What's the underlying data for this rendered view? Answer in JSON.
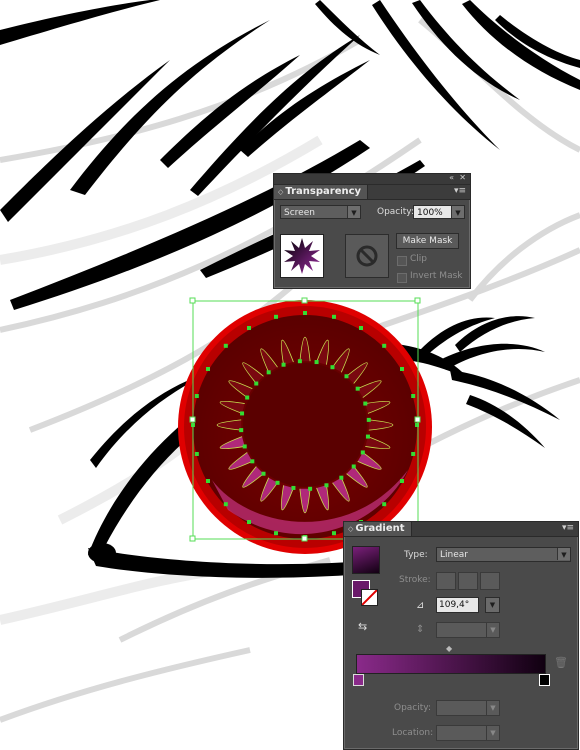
{
  "transparency": {
    "title": "Transparency",
    "blend_mode": "Screen",
    "opacity_label": "Opacity:",
    "opacity_value": "100%",
    "make_mask_label": "Make Mask",
    "clip_label": "Clip",
    "invert_mask_label": "Invert Mask"
  },
  "gradient": {
    "title": "Gradient",
    "type_label": "Type:",
    "type_value": "Linear",
    "stroke_label": "Stroke:",
    "angle_value": "109,4°",
    "opacity_label": "Opacity:",
    "location_label": "Location:",
    "stops": [
      {
        "color": "#8a2a8a",
        "location": 0
      },
      {
        "color": "#000000",
        "location": 100
      }
    ]
  },
  "colors": {
    "iris_outer": "#d40000",
    "iris_inner": "#6a0000",
    "path_anchor": "#33dd33",
    "gradient_start": "#8a2a8a",
    "gradient_end": "#120012",
    "panel_bg": "#4a4a4a"
  }
}
